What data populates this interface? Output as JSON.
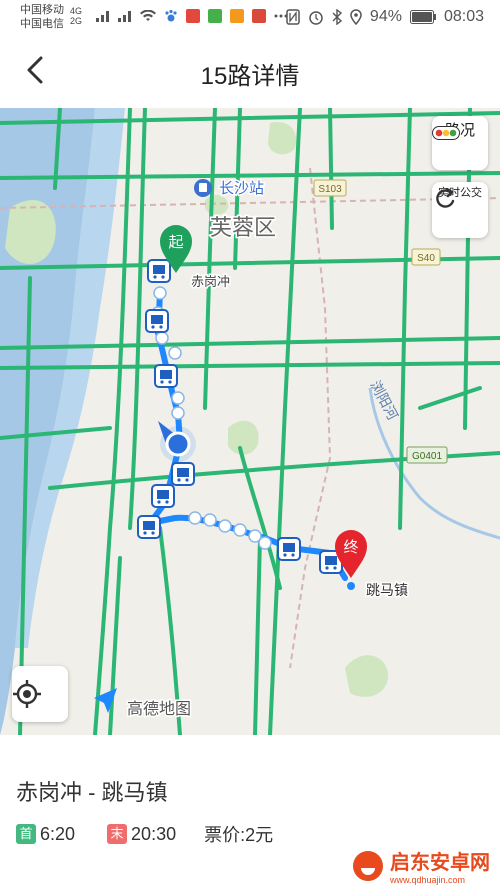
{
  "statusbar": {
    "carrier1": "中国移动",
    "carrier2": "中国电信",
    "net1": "4G",
    "net2": "2G",
    "battery": "94%",
    "time": "08:03"
  },
  "header": {
    "title": "15路详情"
  },
  "map": {
    "labels": {
      "station": "长沙站",
      "district": "芙蓉区",
      "start_stop": "赤岗冲",
      "end_stop": "跳马镇",
      "road1": "S103",
      "road2": "S40",
      "road3": "G0401",
      "river": "浏阳河"
    },
    "start_marker": "起",
    "end_marker": "终",
    "traffic_label": "路况",
    "realtime_label": "实时公交",
    "brand": "高德地图",
    "colors": {
      "road": "#2bb673",
      "route": "#1e88ff",
      "water": "#a5c8e6",
      "start": "#1fa05c",
      "end": "#e5252d"
    }
  },
  "route": {
    "name": "赤岗冲 - 跳马镇",
    "first_tag": "首",
    "first_time": "6:20",
    "last_tag": "末",
    "last_time": "20:30",
    "fare": "票价:2元"
  },
  "watermark": {
    "text": "启东安卓网",
    "url": "www.qdhuajin.com"
  }
}
